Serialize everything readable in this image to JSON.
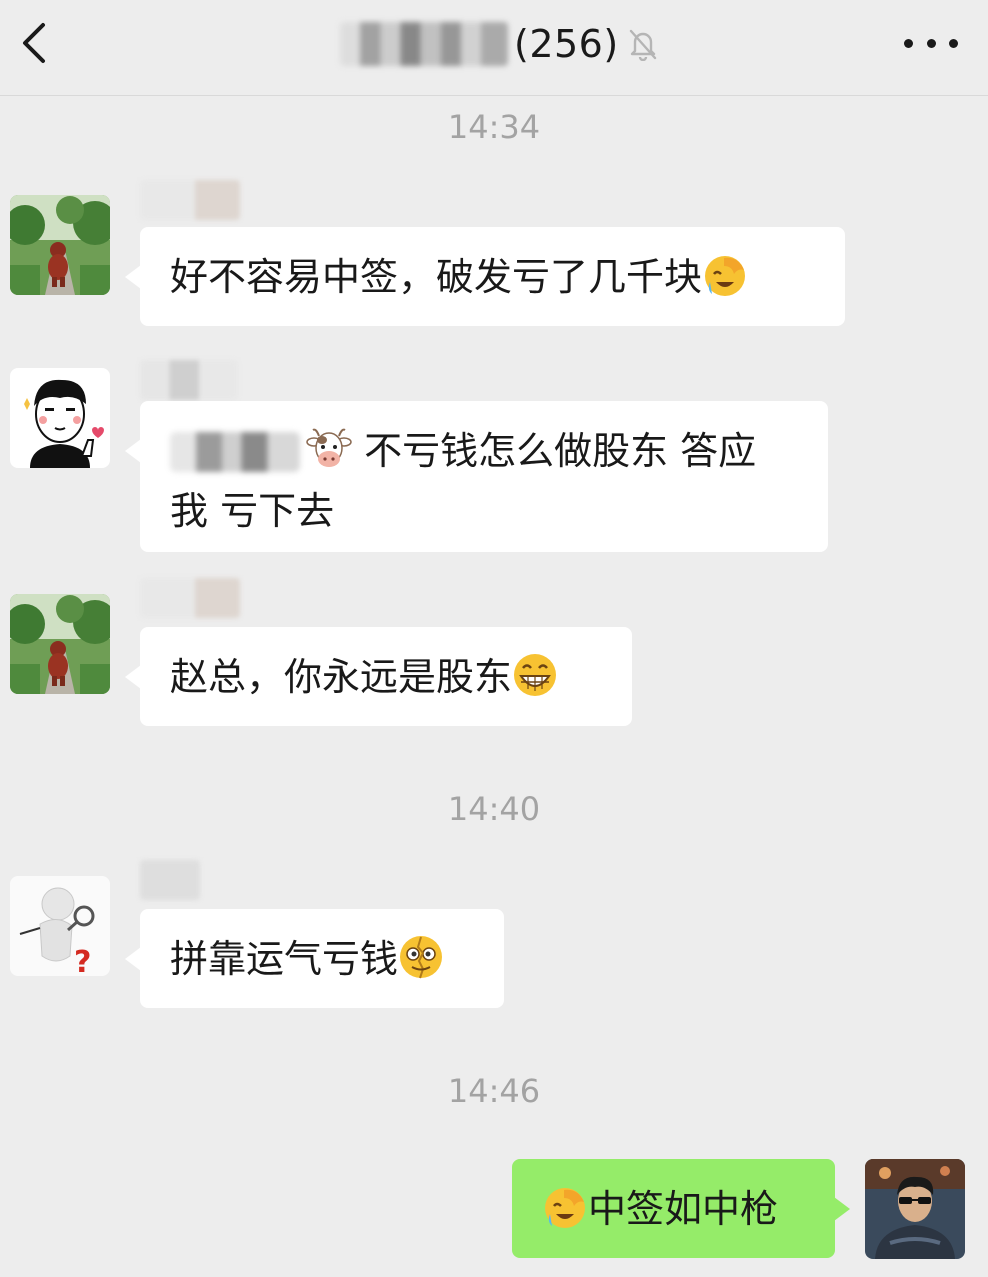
{
  "header": {
    "title_suffix": "(256)",
    "back_icon": "chevron-left-icon",
    "mute_icon": "bell-off-icon",
    "more_icon": "more-dots-icon"
  },
  "messages": [
    {
      "timestamp": "14:34"
    },
    {
      "text": "好不容易中签，破发亏了几千块",
      "emoji": "facepalm-laugh-emoji"
    },
    {
      "text_after_mention": "不亏钱怎么做股东 答应",
      "text_line2": "我 亏下去",
      "emoji": "cow-face-emoji"
    },
    {
      "text": "赵总，你永远是股东",
      "emoji": "grin-emoji"
    },
    {
      "timestamp": "14:40"
    },
    {
      "text": "拼靠运气亏钱",
      "emoji": "cracked-face-emoji"
    },
    {
      "timestamp": "14:46"
    },
    {
      "text": "中签如中枪",
      "emoji": "facepalm-laugh-emoji"
    }
  ],
  "colors": {
    "background": "#ededed",
    "incoming_bubble": "#ffffff",
    "outgoing_bubble": "#95ec69",
    "timestamp": "#a3a3a3"
  }
}
